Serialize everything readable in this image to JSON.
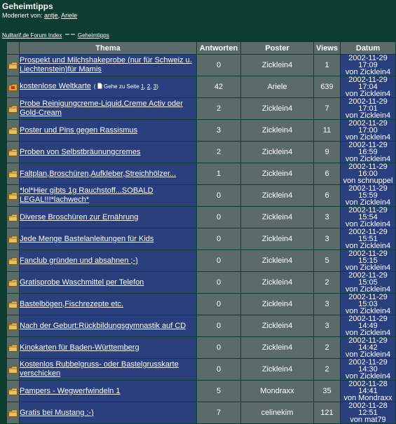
{
  "forum": {
    "title": "Geheimtipps",
    "moderated_by": "Moderiert von:",
    "moderators": [
      "antje",
      "Ariele"
    ]
  },
  "breadcrumb": {
    "index": "Nulltarif.de Forum Index",
    "current": "Geheimtipps"
  },
  "table": {
    "headers": [
      "Thema",
      "Antworten",
      "Poster",
      "Views",
      "Datum"
    ],
    "goto_label": "Gehe zu Seite",
    "rows": [
      {
        "title": "Prospekt und Milchshakeprobe (nur für Schweiz u. Liechtenstein)für Mamis",
        "replies": "0",
        "poster": "Zicklein4",
        "views": "1",
        "date": "2002-11-29 17:09",
        "by": "von Zicklein4",
        "hot": false
      },
      {
        "title": "kostenlose Weltkarte",
        "replies": "42",
        "poster": "Ariele",
        "views": "639",
        "date": "2002-11-29 17:04",
        "by": "von Zicklein4",
        "hot": true,
        "pages": [
          "1",
          "2",
          "3"
        ]
      },
      {
        "title": "Probe Reinigungcreme-Liquid,Creme Activ oder Gold-Cream",
        "replies": "2",
        "poster": "Zicklein4",
        "views": "7",
        "date": "2002-11-29 17:01",
        "by": "von Zicklein4",
        "hot": false
      },
      {
        "title": "Poster und Pins gegen Rassismus",
        "replies": "3",
        "poster": "Zicklein4",
        "views": "11",
        "date": "2002-11-29 17:00",
        "by": "von Zicklein4",
        "hot": false
      },
      {
        "title": "Proben von Selbstbräunungcremes",
        "replies": "2",
        "poster": "Zicklein4",
        "views": "9",
        "date": "2002-11-29 16:59",
        "by": "von Zicklein4",
        "hot": false
      },
      {
        "title": "Faltplan,Broschüren,Aufkleber,Streichhölzer...",
        "replies": "1",
        "poster": "Zicklein4",
        "views": "6",
        "date": "2002-11-29 16:00",
        "by": "von schnuppel",
        "hot": false
      },
      {
        "title": "*lol*Hier gibts 1g Rauchstoff...SOBALD LEGAL!!!*lachwech*",
        "replies": "0",
        "poster": "Zicklein4",
        "views": "6",
        "date": "2002-11-29 15:59",
        "by": "von Zicklein4",
        "hot": false
      },
      {
        "title": "Diverse Broschüren zur Ernährung",
        "replies": "0",
        "poster": "Zicklein4",
        "views": "3",
        "date": "2002-11-29 15:54",
        "by": "von Zicklein4",
        "hot": false
      },
      {
        "title": "Jede Menge Bastelanleitungen für Kids",
        "replies": "0",
        "poster": "Zicklein4",
        "views": "3",
        "date": "2002-11-29 15:51",
        "by": "von Zicklein4",
        "hot": false
      },
      {
        "title": "Fanclub gründen und absahnen ;-)",
        "replies": "0",
        "poster": "Zicklein4",
        "views": "5",
        "date": "2002-11-29 15:15",
        "by": "von Zicklein4",
        "hot": false
      },
      {
        "title": "Gratisprobe Waschmittel per Telefon",
        "replies": "0",
        "poster": "Zicklein4",
        "views": "2",
        "date": "2002-11-29 15:05",
        "by": "von Zicklein4",
        "hot": false
      },
      {
        "title": "Bastelbögen,Fischrezepte etc.",
        "replies": "0",
        "poster": "Zicklein4",
        "views": "3",
        "date": "2002-11-29 15:03",
        "by": "von Zicklein4",
        "hot": false
      },
      {
        "title": "Nach der Geburt:Rückbildungsgymnastik auf CD",
        "replies": "0",
        "poster": "Zicklein4",
        "views": "3",
        "date": "2002-11-29 14:49",
        "by": "von Zicklein4",
        "hot": false
      },
      {
        "title": "Kinokarten für Baden-Württemberg",
        "replies": "0",
        "poster": "Zicklein4",
        "views": "2",
        "date": "2002-11-29 14:42",
        "by": "von Zicklein4",
        "hot": false
      },
      {
        "title": "Kostenlos Rubbelgruss- oder Bastelgrusskarte verschicken",
        "replies": "0",
        "poster": "Zicklein4",
        "views": "2",
        "date": "2002-11-29 14:30",
        "by": "von Zicklein4",
        "hot": false
      },
      {
        "title": "Pampers - Wegwerfwindeln 1",
        "replies": "5",
        "poster": "Mondraxx",
        "views": "35",
        "date": "2002-11-28 14:41",
        "by": "von Mondraxx",
        "hot": false
      },
      {
        "title": "Gratis bei Mustang :-)",
        "replies": "7",
        "poster": "celinekim",
        "views": "121",
        "date": "2002-11-28 12:51",
        "by": "von mat79",
        "hot": false
      }
    ]
  }
}
